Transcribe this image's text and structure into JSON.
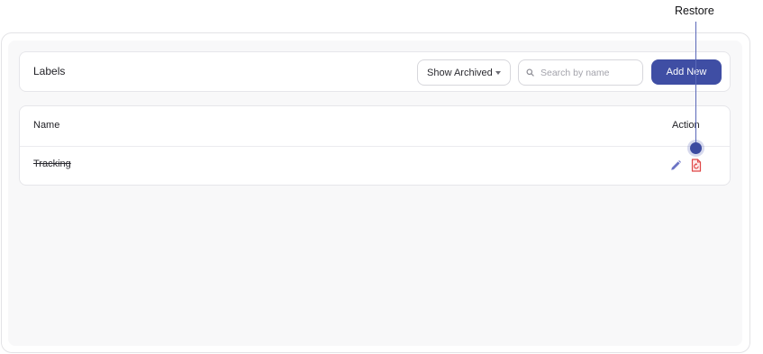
{
  "callout": {
    "label": "Restore"
  },
  "header": {
    "title": "Labels",
    "archive_filter": "Show Archived",
    "search_placeholder": "Search by name",
    "add_button": "Add New"
  },
  "table": {
    "columns": [
      "Name",
      "Action"
    ],
    "rows": [
      {
        "name": "Tracking",
        "archived": true
      }
    ]
  },
  "colors": {
    "accent": "#3f4ea4",
    "edit_icon": "#6b73c4",
    "restore_icon": "#e04848"
  },
  "icons": [
    "search-icon",
    "chevron-down-icon",
    "edit-pencil-icon",
    "restore-icon"
  ]
}
